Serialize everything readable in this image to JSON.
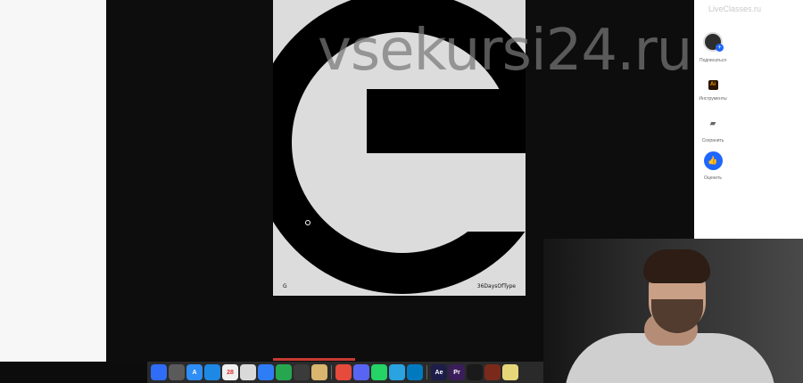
{
  "viewer": {
    "poster": {
      "glyph": "G",
      "label_left": "G",
      "label_right": "36DaysOfType"
    },
    "watermark": "vsekursi24.ru"
  },
  "right_rail": {
    "title": "LiveClasses.ru",
    "subscribe_label": "Подписаться",
    "tools_label": "Инструменты",
    "save_label": "Сохранить",
    "highlight_label": "Оценить"
  },
  "dock": {
    "items": [
      {
        "name": "finder-icon",
        "label": "",
        "color": "#2f6df6"
      },
      {
        "name": "launchpad-icon",
        "label": "",
        "color": "#5a5a5a"
      },
      {
        "name": "app-store-icon",
        "label": "A",
        "color": "#2f8df6"
      },
      {
        "name": "safari-icon",
        "label": "",
        "color": "#1e88e5"
      },
      {
        "name": "calendar-icon",
        "label": "28",
        "color": "#f0f0f0"
      },
      {
        "name": "notes-icon",
        "label": "",
        "color": "#dadada"
      },
      {
        "name": "messages-icon",
        "label": "",
        "color": "#2f7df6"
      },
      {
        "name": "music-icon",
        "label": "",
        "color": "#26a74f"
      },
      {
        "name": "photos-icon",
        "label": "",
        "color": "#3b3b3b"
      },
      {
        "name": "cleaner-icon",
        "label": "",
        "color": "#d9b66f"
      },
      {
        "name": "chrome-icon",
        "label": "",
        "color": "#e64a3a"
      },
      {
        "name": "discord-icon",
        "label": "",
        "color": "#5865f2"
      },
      {
        "name": "whatsapp-icon",
        "label": "",
        "color": "#25d366"
      },
      {
        "name": "telegram-icon",
        "label": "",
        "color": "#2aa3e0"
      },
      {
        "name": "trello-icon",
        "label": "",
        "color": "#0079bf"
      },
      {
        "name": "after-effects-icon",
        "label": "Ae",
        "color": "#1d1d4a"
      },
      {
        "name": "premiere-icon",
        "label": "Pr",
        "color": "#3a1d5a"
      },
      {
        "name": "cinema4d-icon",
        "label": "",
        "color": "#1a1a1a"
      },
      {
        "name": "recorder-icon",
        "label": "",
        "color": "#7a2a1a"
      },
      {
        "name": "bottle-icon",
        "label": "",
        "color": "#e6d67a"
      }
    ]
  }
}
